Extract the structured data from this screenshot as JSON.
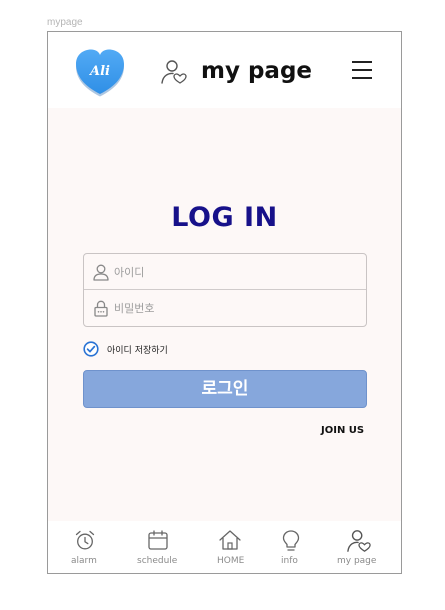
{
  "frame": {
    "label": "mypage"
  },
  "header": {
    "logo_text": "Ali",
    "title": "my page",
    "logo_icon": "heart-logo-icon",
    "user_icon": "user-heart-icon",
    "menu_icon": "hamburger-menu-icon"
  },
  "login": {
    "title": "LOG IN",
    "id_placeholder": "아이디",
    "pw_placeholder": "비밀번호",
    "save_id_label": "아이디 저장하기",
    "save_id_checked": true,
    "submit_label": "로그인",
    "join_label": "JOIN US"
  },
  "tabbar": {
    "items": [
      {
        "label": "alarm",
        "icon": "alarm-clock-icon"
      },
      {
        "label": "schedule",
        "icon": "calendar-icon"
      },
      {
        "label": "HOME",
        "icon": "home-icon"
      },
      {
        "label": "info",
        "icon": "lightbulb-icon"
      },
      {
        "label": "my page",
        "icon": "user-heart-icon"
      }
    ]
  },
  "colors": {
    "title": "#17118a",
    "button": "#86a7dc",
    "check": "#2a73d4",
    "logo": "#3f9df0",
    "background": "#fdf8f7"
  }
}
